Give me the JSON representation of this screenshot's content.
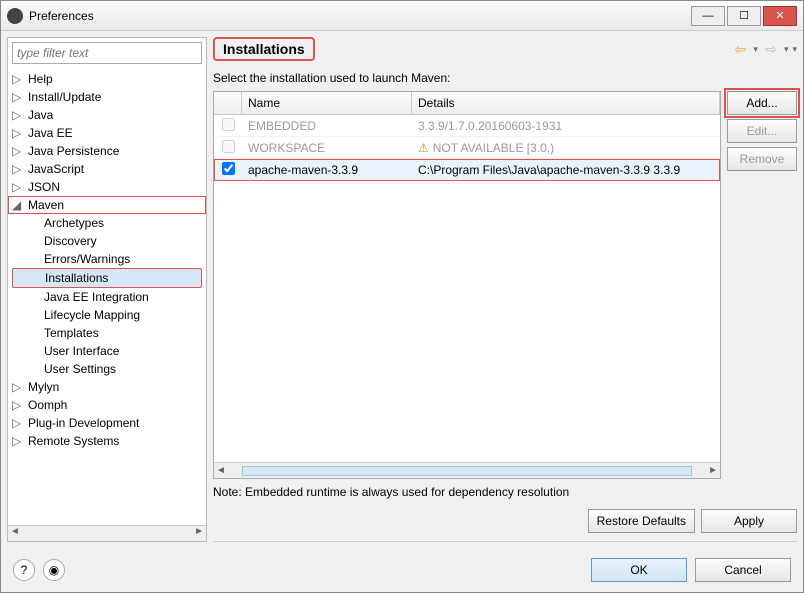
{
  "window": {
    "title": "Preferences"
  },
  "filter": {
    "placeholder": "type filter text"
  },
  "tree": [
    {
      "label": "Help",
      "tw": "▷"
    },
    {
      "label": "Install/Update",
      "tw": "▷"
    },
    {
      "label": "Java",
      "tw": "▷"
    },
    {
      "label": "Java EE",
      "tw": "▷"
    },
    {
      "label": "Java Persistence",
      "tw": "▷"
    },
    {
      "label": "JavaScript",
      "tw": "▷"
    },
    {
      "label": "JSON",
      "tw": "▷"
    },
    {
      "label": "Maven",
      "tw": "◢",
      "hl": true
    },
    {
      "label": "Archetypes",
      "child": true
    },
    {
      "label": "Discovery",
      "child": true
    },
    {
      "label": "Errors/Warnings",
      "child": true
    },
    {
      "label": "Installations",
      "child": true,
      "sel": true,
      "hl": true
    },
    {
      "label": "Java EE Integration",
      "child": true
    },
    {
      "label": "Lifecycle Mapping",
      "child": true
    },
    {
      "label": "Templates",
      "child": true
    },
    {
      "label": "User Interface",
      "child": true
    },
    {
      "label": "User Settings",
      "child": true
    },
    {
      "label": "Mylyn",
      "tw": "▷"
    },
    {
      "label": "Oomph",
      "tw": "▷"
    },
    {
      "label": "Plug-in Development",
      "tw": "▷"
    },
    {
      "label": "Remote Systems",
      "tw": "▷"
    }
  ],
  "page": {
    "title": "Installations",
    "instruction": "Select the installation used to launch Maven:",
    "columns": {
      "name": "Name",
      "details": "Details"
    },
    "rows": [
      {
        "checked": false,
        "disabled": true,
        "name": "EMBEDDED",
        "details": "3.3.9/1.7.0.20160603-1931"
      },
      {
        "checked": false,
        "disabled": true,
        "name": "WORKSPACE",
        "details": "NOT AVAILABLE [3.0,)",
        "warn": true
      },
      {
        "checked": true,
        "disabled": false,
        "name": "apache-maven-3.3.9",
        "details": "C:\\Program Files\\Java\\apache-maven-3.3.9 3.3.9",
        "sel": true
      }
    ],
    "buttons": {
      "add": "Add...",
      "edit": "Edit...",
      "remove": "Remove"
    },
    "note": "Note: Embedded runtime is always used for dependency resolution",
    "restore": "Restore Defaults",
    "apply": "Apply"
  },
  "footer": {
    "ok": "OK",
    "cancel": "Cancel"
  }
}
